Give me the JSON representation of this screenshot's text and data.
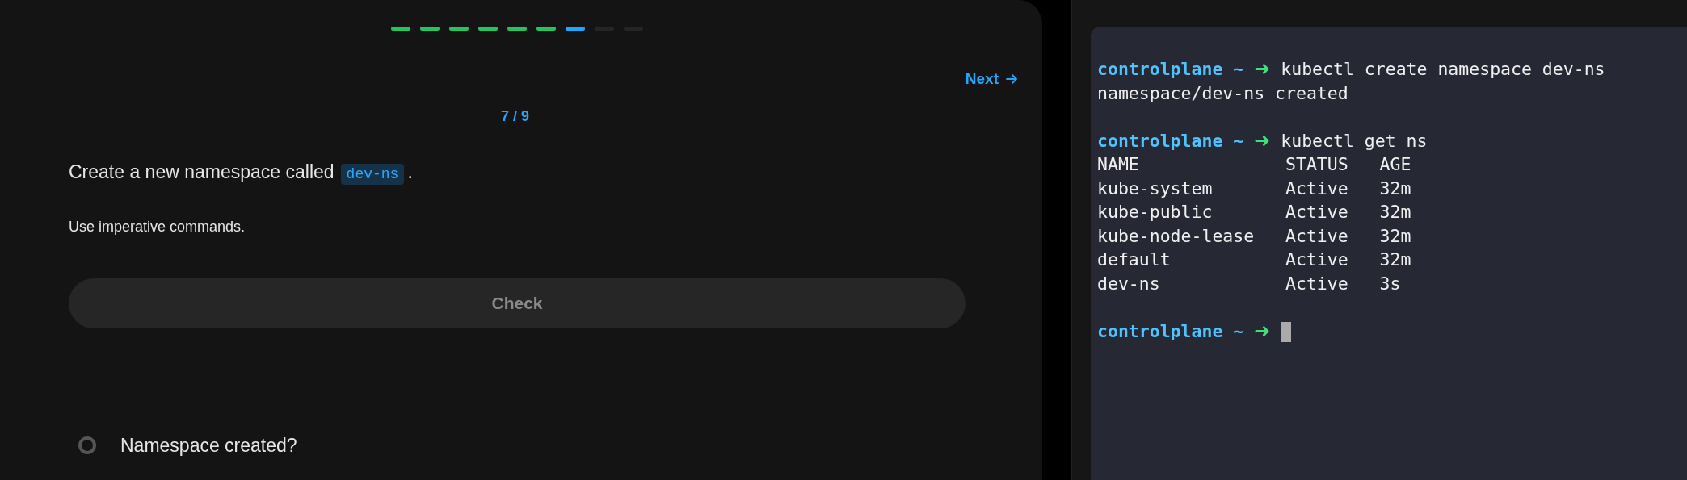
{
  "progress": [
    {
      "completed": true,
      "selected": false
    },
    {
      "completed": true,
      "selected": false
    },
    {
      "completed": true,
      "selected": false
    },
    {
      "completed": true,
      "selected": false
    },
    {
      "completed": true,
      "selected": false
    },
    {
      "completed": true,
      "selected": false
    },
    {
      "completed": false,
      "selected": true
    },
    {
      "completed": false,
      "selected": false
    },
    {
      "completed": false,
      "selected": false
    }
  ],
  "next_link": "Next",
  "step_counter": "7 / 9",
  "question": {
    "before": "Create a new namespace called",
    "code": "dev-ns",
    "after": "."
  },
  "hint": "Use imperative commands.",
  "check_button": "Check",
  "tasks": [
    {
      "label": "Namespace created?",
      "done": false
    }
  ],
  "terminal": {
    "lines": [
      {
        "kind": "prompt",
        "host": "controlplane",
        "dir": "~",
        "symbol": "➜",
        "text": "kubectl create namespace dev-ns"
      },
      {
        "kind": "output",
        "text": "namespace/dev-ns created"
      },
      {
        "kind": "blank"
      },
      {
        "kind": "prompt",
        "host": "controlplane",
        "dir": "~",
        "symbol": "➜",
        "text": "kubectl get ns"
      },
      {
        "kind": "output",
        "text": "NAME              STATUS   AGE"
      },
      {
        "kind": "output",
        "text": "kube-system       Active   32m"
      },
      {
        "kind": "output",
        "text": "kube-public       Active   32m"
      },
      {
        "kind": "output",
        "text": "kube-node-lease   Active   32m"
      },
      {
        "kind": "output",
        "text": "default           Active   32m"
      },
      {
        "kind": "output",
        "text": "dev-ns            Active   3s"
      },
      {
        "kind": "blank"
      },
      {
        "kind": "prompt",
        "host": "controlplane",
        "dir": "~",
        "symbol": "➜",
        "cursor": true
      }
    ]
  }
}
